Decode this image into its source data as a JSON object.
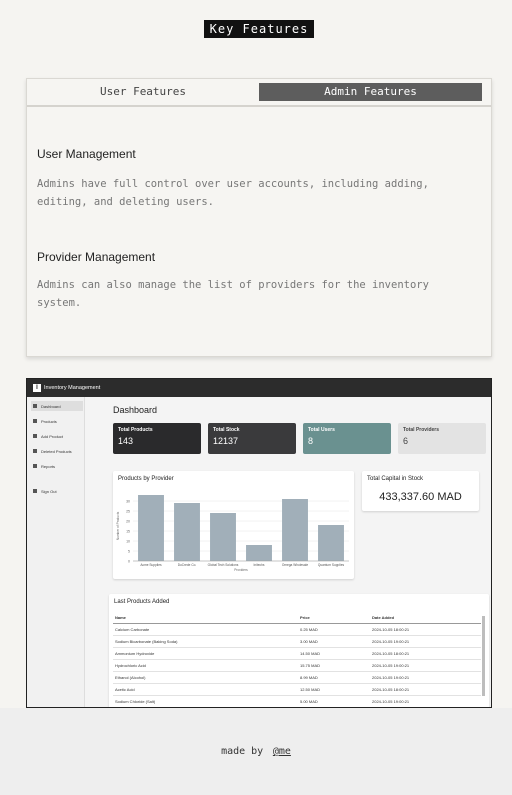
{
  "heading": "Key Features",
  "tabs": {
    "user": "User Features",
    "admin": "Admin Features"
  },
  "sections": [
    {
      "title": "User Management",
      "text": "Admins have full control over user accounts, including adding, editing, and deleting users."
    },
    {
      "title": "Provider Management",
      "text": "Admins can also manage the list of providers for the inventory system."
    }
  ],
  "screenshot": {
    "app_title": "Inventory Management",
    "sidebar": [
      "Dashboard",
      "Products",
      "Add Product",
      "Deleted Products",
      "Reports",
      "Sign Out"
    ],
    "dashboard_title": "Dashboard",
    "stats": [
      {
        "label": "Total Products",
        "value": "143",
        "color": "#2a2a2c"
      },
      {
        "label": "Total Stock",
        "value": "12137",
        "color": "#3a3a3c"
      },
      {
        "label": "Total Users",
        "value": "8",
        "color": "#6a9190"
      },
      {
        "label": "Total Providers",
        "value": "6",
        "color": "#e3e3e3"
      }
    ],
    "chart_title": "Products by Provider",
    "capital_title": "Total Capital in Stock",
    "capital_value": "433,337.60 MAD",
    "table_title": "Last Products Added",
    "table_headers": [
      "Name",
      "Price",
      "Date Added"
    ],
    "table_rows": [
      [
        "Calcium Carbonate",
        "0.25 MAD",
        "2024-10-05 18:00:21"
      ],
      [
        "Sodium Bicarbonate (Baking Soda)",
        "3.00 MAD",
        "2024-10-05 19:00:21"
      ],
      [
        "Ammonium Hydroxide",
        "14.50 MAD",
        "2024-10-05 18:00:21"
      ],
      [
        "Hydrochloric Acid",
        "15.75 MAD",
        "2024-10-05 19:00:21"
      ],
      [
        "Ethanol (Alcohol)",
        "8.99 MAD",
        "2024-10-05 19:00:21"
      ],
      [
        "Acetic Acid",
        "12.50 MAD",
        "2024-10-05 18:00:21"
      ],
      [
        "Sodium Chloride (Salt)",
        "5.00 MAD",
        "2024-10-05 19:00:21"
      ]
    ]
  },
  "chart_data": {
    "type": "bar",
    "title": "Products by Provider",
    "categories": [
      "Acme Supplies",
      "DuCrede Co.",
      "Global Tech Solutions",
      "Initechs",
      "Omega Wholesale",
      "Quantum Supplies"
    ],
    "values": [
      33,
      29,
      24,
      8,
      31,
      18
    ],
    "ylim": [
      0,
      35
    ],
    "yticks": [
      0,
      5,
      10,
      15,
      20,
      25,
      30
    ],
    "xlabel": "Providers",
    "ylabel": "Number of Products",
    "bar_color": "#a1afb9"
  },
  "footer": {
    "text": "made by",
    "link": "@me"
  }
}
